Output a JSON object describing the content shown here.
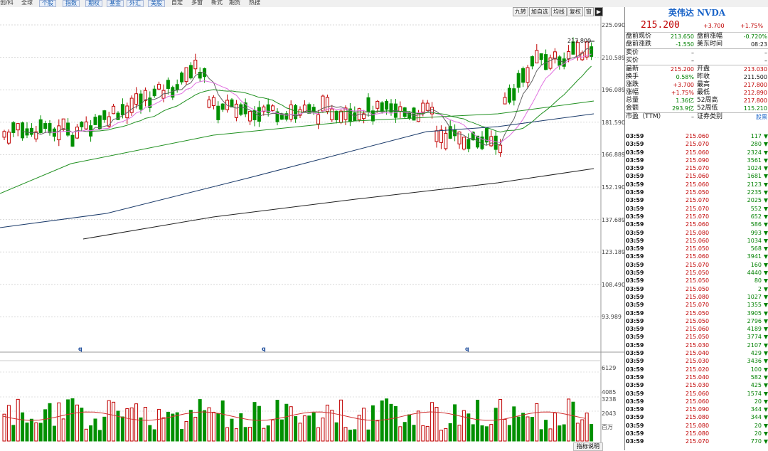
{
  "topbar": {
    "tabs": [
      "创/科",
      "全球",
      "个股",
      "指数",
      "期权",
      "基金",
      "外汇",
      "美股",
      "自定",
      "多窗",
      "新式",
      "期货",
      "热搜"
    ]
  },
  "toolbar": {
    "buttons": [
      "九转",
      "加自选",
      "均线",
      "复权",
      "窗"
    ]
  },
  "price_axis": [
    "225.090",
    "210.589",
    "196.089",
    "181.590",
    "166.889",
    "152.190",
    "137.689",
    "123.189",
    "108.490",
    "93.989"
  ],
  "vol_axis": [
    "6129",
    "4085",
    "3238",
    "2043"
  ],
  "vol_unit": "百万",
  "high_marker": "217.800",
  "q_markers": [
    "q",
    "q",
    "q"
  ],
  "footer_button": "指标说明",
  "colors": {
    "up": "#c00000",
    "down": "#009000",
    "ma5": "#606060",
    "ma10": "#e070e0",
    "ma20": "#209020",
    "ma60": "#1a3a6a",
    "ma120": "#202020"
  },
  "quote": {
    "name": "英伟达 NVDA",
    "price": "215.200",
    "change": "+3.700",
    "pct": "+1.75%",
    "rows": [
      {
        "l1": "盘前现价",
        "v1": "213.650",
        "c1": "green",
        "l2": "盘前涨幅",
        "v2": "-0.720%",
        "c2": "green"
      },
      {
        "l1": "盘前涨跌",
        "v1": "-1.550",
        "c1": "green",
        "l2": "美东时间",
        "v2": "08:23",
        "c2": "blk"
      },
      {
        "l1": "卖价",
        "v1": "–",
        "c1": "blk",
        "l2": "",
        "v2": "–",
        "c2": "blk"
      },
      {
        "l1": "买价",
        "v1": "–",
        "c1": "blk",
        "l2": "",
        "v2": "–",
        "c2": "blk"
      },
      {
        "l1": "最新",
        "v1": "215.200",
        "c1": "red",
        "l2": "开盘",
        "v2": "213.030",
        "c2": "red"
      },
      {
        "l1": "换手",
        "v1": "0.58%",
        "c1": "green",
        "l2": "昨收",
        "v2": "211.500",
        "c2": "blk"
      },
      {
        "l1": "涨跌",
        "v1": "+3.700",
        "c1": "red",
        "l2": "最高",
        "v2": "217.800",
        "c2": "red"
      },
      {
        "l1": "涨幅",
        "v1": "+1.75%",
        "c1": "red",
        "l2": "最低",
        "v2": "212.890",
        "c2": "red"
      },
      {
        "l1": "总量",
        "v1": "1.36亿",
        "c1": "green",
        "l2": "52周高",
        "v2": "217.800",
        "c2": "red"
      },
      {
        "l1": "金额",
        "v1": "293.9亿",
        "c1": "green",
        "l2": "52周低",
        "v2": "115.210",
        "c2": "green"
      },
      {
        "l1": "市盈（TTM）",
        "v1": "–",
        "c1": "blk",
        "l2": "证券类别",
        "v2": "股票",
        "c2": "blu"
      }
    ],
    "ticks": [
      {
        "t": "03:59",
        "p": "215.060",
        "v": "117"
      },
      {
        "t": "03:59",
        "p": "215.070",
        "v": "280"
      },
      {
        "t": "03:59",
        "p": "215.060",
        "v": "2324"
      },
      {
        "t": "03:59",
        "p": "215.090",
        "v": "3561"
      },
      {
        "t": "03:59",
        "p": "215.070",
        "v": "1024"
      },
      {
        "t": "03:59",
        "p": "215.060",
        "v": "1681"
      },
      {
        "t": "03:59",
        "p": "215.060",
        "v": "2123"
      },
      {
        "t": "03:59",
        "p": "215.050",
        "v": "2235"
      },
      {
        "t": "03:59",
        "p": "215.070",
        "v": "2025"
      },
      {
        "t": "03:59",
        "p": "215.070",
        "v": "552"
      },
      {
        "t": "03:59",
        "p": "215.070",
        "v": "652"
      },
      {
        "t": "03:59",
        "p": "215.060",
        "v": "586"
      },
      {
        "t": "03:59",
        "p": "215.080",
        "v": "993"
      },
      {
        "t": "03:59",
        "p": "215.060",
        "v": "1034"
      },
      {
        "t": "03:59",
        "p": "215.050",
        "v": "568"
      },
      {
        "t": "03:59",
        "p": "215.060",
        "v": "3941"
      },
      {
        "t": "03:59",
        "p": "215.070",
        "v": "160"
      },
      {
        "t": "03:59",
        "p": "215.050",
        "v": "4440"
      },
      {
        "t": "03:59",
        "p": "215.050",
        "v": "80"
      },
      {
        "t": "03:59",
        "p": "215.050",
        "v": "2"
      },
      {
        "t": "03:59",
        "p": "215.080",
        "v": "1027"
      },
      {
        "t": "03:59",
        "p": "215.070",
        "v": "1355"
      },
      {
        "t": "03:59",
        "p": "215.050",
        "v": "3905"
      },
      {
        "t": "03:59",
        "p": "215.050",
        "v": "2796"
      },
      {
        "t": "03:59",
        "p": "215.060",
        "v": "4189"
      },
      {
        "t": "03:59",
        "p": "215.050",
        "v": "3774"
      },
      {
        "t": "03:59",
        "p": "215.030",
        "v": "2107"
      },
      {
        "t": "03:59",
        "p": "215.040",
        "v": "429"
      },
      {
        "t": "03:59",
        "p": "215.030",
        "v": "3436"
      },
      {
        "t": "03:59",
        "p": "215.020",
        "v": "100"
      },
      {
        "t": "03:59",
        "p": "215.040",
        "v": "582"
      },
      {
        "t": "03:59",
        "p": "215.030",
        "v": "425"
      },
      {
        "t": "03:59",
        "p": "215.060",
        "v": "1574"
      },
      {
        "t": "03:59",
        "p": "215.060",
        "v": "20"
      },
      {
        "t": "03:59",
        "p": "215.090",
        "v": "344"
      },
      {
        "t": "03:59",
        "p": "215.080",
        "v": "344"
      },
      {
        "t": "03:59",
        "p": "215.080",
        "v": "20"
      },
      {
        "t": "03:59",
        "p": "215.080",
        "v": "20"
      },
      {
        "t": "03:59",
        "p": "215.070",
        "v": "770"
      }
    ]
  }
}
